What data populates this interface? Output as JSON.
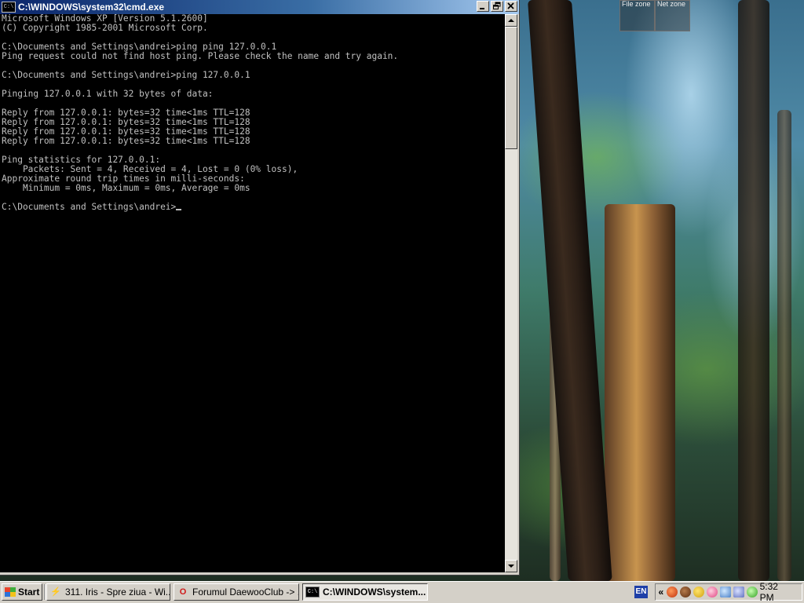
{
  "window": {
    "title": "C:\\WINDOWS\\system32\\cmd.exe",
    "icon_text": "C:\\"
  },
  "console_lines": [
    "Microsoft Windows XP [Version 5.1.2600]",
    "(C) Copyright 1985-2001 Microsoft Corp.",
    "",
    "C:\\Documents and Settings\\andrei>ping ping 127.0.0.1",
    "Ping request could not find host ping. Please check the name and try again.",
    "",
    "C:\\Documents and Settings\\andrei>ping 127.0.0.1",
    "",
    "Pinging 127.0.0.1 with 32 bytes of data:",
    "",
    "Reply from 127.0.0.1: bytes=32 time<1ms TTL=128",
    "Reply from 127.0.0.1: bytes=32 time<1ms TTL=128",
    "Reply from 127.0.0.1: bytes=32 time<1ms TTL=128",
    "Reply from 127.0.0.1: bytes=32 time<1ms TTL=128",
    "",
    "Ping statistics for 127.0.0.1:",
    "    Packets: Sent = 4, Received = 4, Lost = 0 (0% loss),",
    "Approximate round trip times in milli-seconds:",
    "    Minimum = 0ms, Maximum = 0ms, Average = 0ms",
    "",
    "C:\\Documents and Settings\\andrei>"
  ],
  "desktop": {
    "zones": [
      "File zone",
      "Net zone"
    ]
  },
  "taskbar": {
    "start_label": "Start",
    "tasks": [
      {
        "label": "311. Iris - Spre ziua - Wi...",
        "icon": "winamp-icon"
      },
      {
        "label": "Forumul DaewooClub -> ...",
        "icon": "opera-icon"
      },
      {
        "label": "C:\\WINDOWS\\system...",
        "icon": "cmd-icon"
      }
    ],
    "language": "EN",
    "clock": "5:32 PM",
    "tray_icons": [
      "antivirus-icon",
      "sound-icon",
      "messenger-icon",
      "smiley-icon",
      "network-icon",
      "display-icon",
      "update-icon"
    ]
  },
  "colors": {
    "titlebar_start": "#0a246a",
    "titlebar_end": "#a6caf0",
    "console_bg": "#000000",
    "console_fg": "#c0c0c0",
    "taskbar_bg": "#d4d0c8"
  }
}
